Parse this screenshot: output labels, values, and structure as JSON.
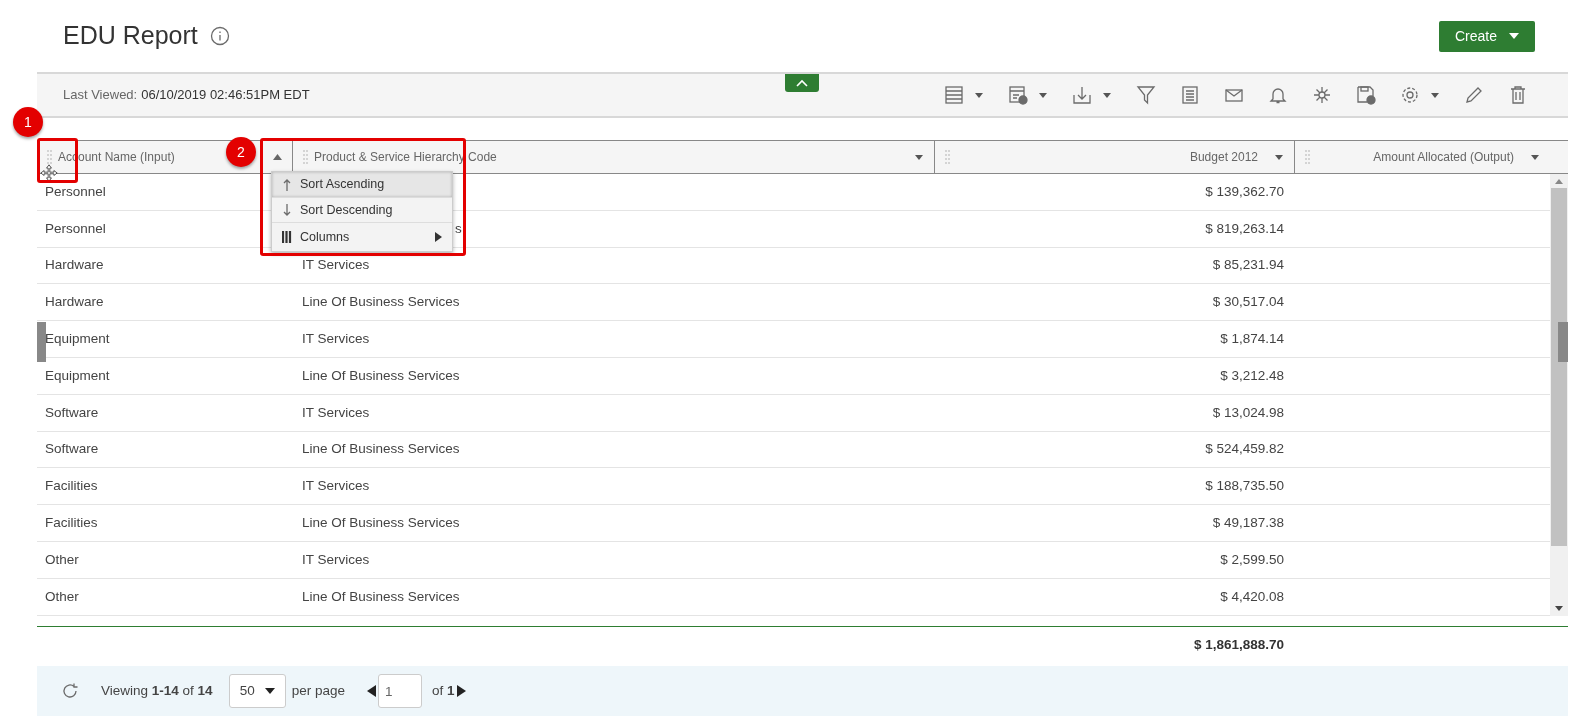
{
  "title": "EDU Report",
  "create_button": "Create",
  "last_viewed": {
    "label": "Last Viewed:",
    "value": "06/10/2019 02:46:51PM EDT"
  },
  "columns": [
    {
      "label": "Account Name (Input)",
      "sorted": true
    },
    {
      "label": "Product & Service Hierarchy Code",
      "sorted": false
    },
    {
      "label": "Budget 2012",
      "sorted": false
    },
    {
      "label": "Amount Allocated (Output)",
      "sorted": false
    }
  ],
  "rows": [
    {
      "account": "Personnel",
      "budget": "$ 139,362.70"
    },
    {
      "account": "Personnel",
      "product": "s",
      "partly_covered": true,
      "budget": "$ 819,263.14"
    },
    {
      "account": "Hardware",
      "product": "IT Services",
      "budget": "$ 85,231.94"
    },
    {
      "account": "Hardware",
      "product": "Line Of Business Services",
      "budget": "$ 30,517.04"
    },
    {
      "account": "Equipment",
      "product": "IT Services",
      "budget": "$ 1,874.14"
    },
    {
      "account": "Equipment",
      "product": "Line Of Business Services",
      "budget": "$ 3,212.48"
    },
    {
      "account": "Software",
      "product": "IT Services",
      "budget": "$ 13,024.98"
    },
    {
      "account": "Software",
      "product": "Line Of Business Services",
      "budget": "$ 524,459.82"
    },
    {
      "account": "Facilities",
      "product": "IT Services",
      "budget": "$ 188,735.50"
    },
    {
      "account": "Facilities",
      "product": "Line Of Business Services",
      "budget": "$ 49,187.38"
    },
    {
      "account": "Other",
      "product": "IT Services",
      "budget": "$ 2,599.50"
    },
    {
      "account": "Other",
      "product": "Line Of Business Services",
      "budget": "$ 4,420.08"
    }
  ],
  "column_menu": [
    {
      "label": "Sort Ascending",
      "kind": "asc",
      "selected": true
    },
    {
      "label": "Sort Descending",
      "kind": "desc",
      "selected": false
    },
    {
      "label": "Columns",
      "kind": "submenu",
      "selected": false
    }
  ],
  "total": "$ 1,861,888.70",
  "footer": {
    "viewing": "Viewing **1-14** of **14**",
    "per_page": "50",
    "per_page_label": "per page",
    "page": "1",
    "of_pages": "of **1**"
  },
  "callouts": [
    "1",
    "2"
  ]
}
